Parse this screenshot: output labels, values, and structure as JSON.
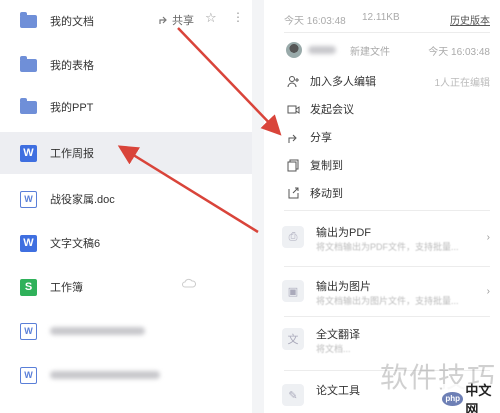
{
  "file_list": [
    {
      "name": "我的文档",
      "type": "folder",
      "share_label": "共享"
    },
    {
      "name": "我的表格",
      "type": "folder"
    },
    {
      "name": "我的PPT",
      "type": "folder"
    },
    {
      "name": "工作周报",
      "type": "word",
      "selected": true
    },
    {
      "name": "战役家属.doc",
      "type": "word-outline"
    },
    {
      "name": "文字文稿6",
      "type": "word"
    },
    {
      "name": "工作簿",
      "type": "sheet"
    },
    {
      "name": "",
      "type": "word-outline-blurred"
    },
    {
      "name": "",
      "type": "word-outline-blurred"
    }
  ],
  "icons": {
    "folder": "folder-icon",
    "word": "W",
    "sheet": "S",
    "share": "share-icon",
    "star": "☆",
    "more": "⋮",
    "cloud": "cloud-icon"
  },
  "detail": {
    "modified_time": "今天 16:03:48",
    "file_size": "12.11KB",
    "history_label": "历史版本",
    "collaborator": {
      "action": "新建文件",
      "time": "今天 16:03:48"
    },
    "menu": [
      {
        "label": "加入多人编辑",
        "hint": "1人正在编辑",
        "icon": "add-user-icon"
      },
      {
        "label": "发起会议",
        "icon": "video-icon"
      },
      {
        "label": "分享",
        "icon": "share-icon"
      },
      {
        "label": "复制到",
        "icon": "copy-icon"
      },
      {
        "label": "移动到",
        "icon": "move-icon"
      }
    ],
    "exports": [
      {
        "title": "输出为PDF",
        "desc": "将文档输出为PDF文件，支持批量...",
        "icon": "pdf-icon"
      },
      {
        "title": "输出为图片",
        "desc": "将文档输出为图片文件，支持批量...",
        "icon": "image-icon"
      },
      {
        "title": "全文翻译",
        "desc": "将文档...",
        "icon": "translate-icon"
      },
      {
        "title": "论文工具",
        "desc": "",
        "icon": "paper-icon"
      }
    ]
  },
  "watermark": "软件技巧",
  "logo": {
    "badge": "php",
    "text": "中文网"
  },
  "colors": {
    "accent": "#3f6fe0",
    "sheet": "#2fb15a",
    "arrow": "#d9443a"
  }
}
